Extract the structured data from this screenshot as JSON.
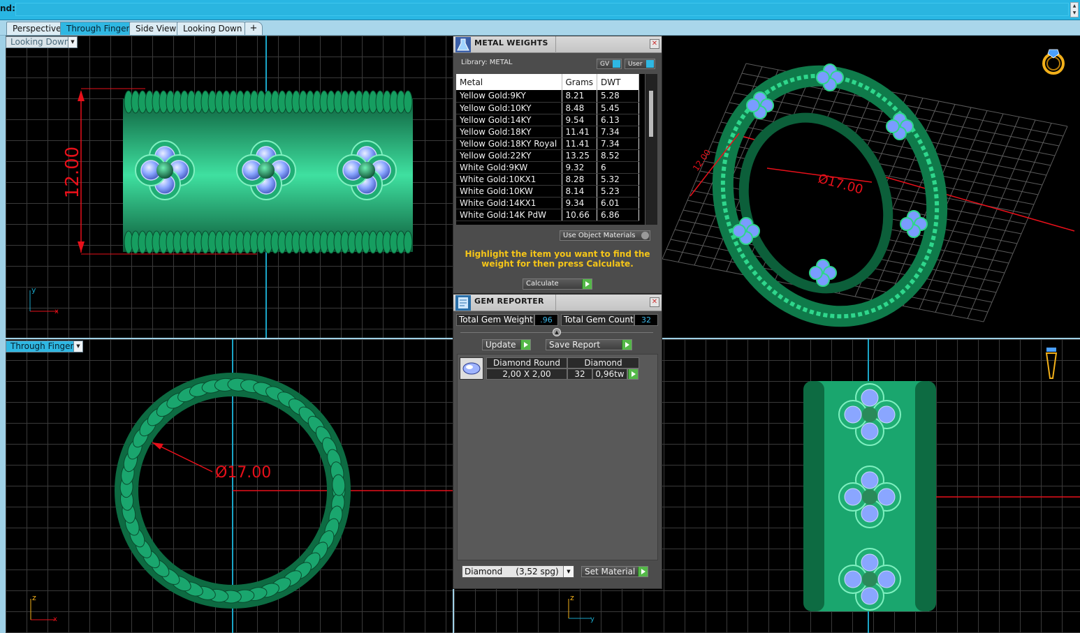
{
  "command": {
    "label": "nd:",
    "value": ""
  },
  "tabs": [
    {
      "label": "Perspective",
      "active": false
    },
    {
      "label": "Through Finger",
      "active": true
    },
    {
      "label": "Side View",
      "active": false
    },
    {
      "label": "Looking Down",
      "active": false
    },
    {
      "label": "+",
      "active": false
    }
  ],
  "viewports": {
    "top_left": {
      "label": "Looking Down",
      "dimension": "12.00",
      "axis_x": "x",
      "axis_y": "y"
    },
    "top_right": {
      "dimension_diameter": "Ø17.00",
      "dimension_width": "12.00"
    },
    "bottom_left": {
      "label": "Through Finger",
      "dimension": "Ø17.00",
      "axis_x": "x",
      "axis_y": "z"
    },
    "bottom_right": {
      "axis_x": "y",
      "axis_y": "z"
    }
  },
  "metal_weights": {
    "title": "METAL WEIGHTS",
    "library_label": "Library: METAL",
    "toggle_gv": "GV",
    "toggle_user": "User",
    "columns": [
      "Metal",
      "Grams",
      "DWT"
    ],
    "rows": [
      [
        "Yellow Gold:9KY",
        "8.21",
        "5.28"
      ],
      [
        "Yellow Gold:10KY",
        "8.48",
        "5.45"
      ],
      [
        "Yellow Gold:14KY",
        "9.54",
        "6.13"
      ],
      [
        "Yellow Gold:18KY",
        "11.41",
        "7.34"
      ],
      [
        "Yellow Gold:18KY Royal",
        "11.41",
        "7.34"
      ],
      [
        "Yellow Gold:22KY",
        "13.25",
        "8.52"
      ],
      [
        "White Gold:9KW",
        "9.32",
        "6"
      ],
      [
        "White Gold:10KX1",
        "8.28",
        "5.32"
      ],
      [
        "White Gold:10KW",
        "8.14",
        "5.23"
      ],
      [
        "White Gold:14KX1",
        "9.34",
        "6.01"
      ],
      [
        "White Gold:14K PdW",
        "10.66",
        "6.86"
      ]
    ],
    "use_object_materials": "Use Object Materials",
    "instruction": "Highlight the item you want to find the weight for then press Calculate.",
    "calculate": "Calculate"
  },
  "gem_reporter": {
    "title": "GEM REPORTER",
    "total_weight_label": "Total Gem Weight",
    "total_weight_value": ".96",
    "total_count_label": "Total Gem Count",
    "total_count_value": "32",
    "update": "Update",
    "save_report": "Save Report",
    "gem": {
      "shape": "Diamond Round",
      "material": "Diamond",
      "size": "2,00 X 2,00",
      "count": "32",
      "weight": "0,96tw"
    },
    "material_select": "Diamond",
    "material_spg": "(3,52 spg)",
    "set_material": "Set Material"
  },
  "colors": {
    "accent": "#2fb7e2",
    "metal": "#1fae74",
    "gem": "#7a9cff",
    "dimension": "#e8101a"
  }
}
